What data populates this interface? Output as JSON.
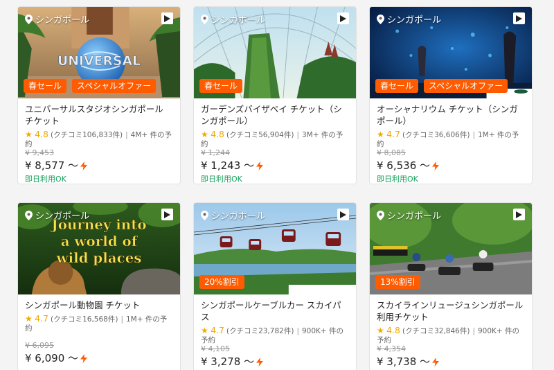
{
  "cards": [
    {
      "location": "シンガポール",
      "badges": [
        "春セール",
        "スペシャルオファー"
      ],
      "title": "ユニバーサルスタジオシンガポール チケット",
      "score": "4.8",
      "reviews": "(クチコミ106,833件)",
      "booked": "4M+ 件の予約",
      "original_price": "¥ 9,453",
      "price": "¥ 8,577 〜",
      "availability": "即日利用OK",
      "image_text": "UNIVERSAL"
    },
    {
      "location": "シンガポール",
      "badges": [
        "春セール"
      ],
      "title": "ガーデンズバイザベイ チケット（シンガポール）",
      "score": "4.8",
      "reviews": "(クチコミ56,904件)",
      "booked": "3M+ 件の予約",
      "original_price": "¥ 1,244",
      "price": "¥ 1,243 〜",
      "availability": "即日利用OK"
    },
    {
      "location": "シンガポール",
      "badges": [
        "春セール",
        "スペシャルオファー"
      ],
      "title": "オーシャナリウム チケット（シンガポール）",
      "score": "4.7",
      "reviews": "(クチコミ36,606件)",
      "booked": "1M+ 件の予約",
      "original_price": "¥ 8,085",
      "price": "¥ 6,536 〜",
      "availability": "即日利用OK"
    },
    {
      "location": "シンガポール",
      "badges": [],
      "title": "シンガポール動物園 チケット",
      "score": "4.7",
      "reviews": "(クチコミ16,568件)",
      "booked": "1M+ 件の予約",
      "original_price": "¥ 6,095",
      "price": "¥ 6,090 〜",
      "availability": "",
      "image_text": [
        "Journey into",
        "a world of",
        "wild places"
      ]
    },
    {
      "location": "シンガポール",
      "badges": [
        "20%割引"
      ],
      "title": "シンガポールケーブルカー スカイパス",
      "score": "4.7",
      "reviews": "(クチコミ23,782件)",
      "booked": "900K+ 件の予約",
      "original_price": "¥ 4,105",
      "price": "¥ 3,278 〜",
      "availability": ""
    },
    {
      "location": "シンガポール",
      "badges": [
        "13%割引"
      ],
      "title": "スカイラインリュージュシンガポール 利用チケット",
      "score": "4.8",
      "reviews": "(クチコミ32,846件)",
      "booked": "900K+ 件の予約",
      "original_price": "¥ 4,354",
      "price": "¥ 3,738 〜",
      "availability": ""
    }
  ],
  "colors": {
    "badge": "#ff5b00",
    "star": "#f4a800",
    "available": "#16a05c"
  }
}
